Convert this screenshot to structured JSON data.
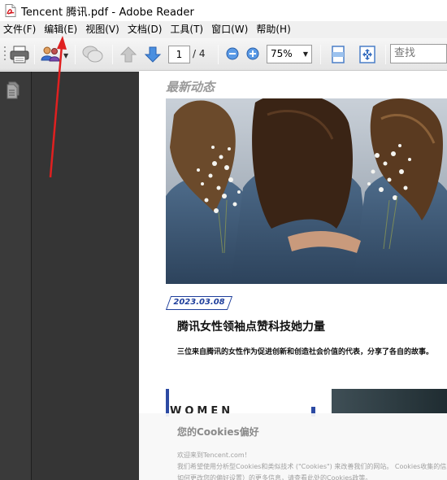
{
  "window": {
    "title": "Tencent 腾讯.pdf - Adobe Reader"
  },
  "menu": {
    "items": [
      "文件(F)",
      "编辑(E)",
      "视图(V)",
      "文档(D)",
      "工具(T)",
      "窗口(W)",
      "帮助(H)"
    ]
  },
  "toolbar": {
    "current_page": "1",
    "total_pages": "/ 4",
    "zoom": "75%",
    "search_placeholder": "查找"
  },
  "document": {
    "section_title": "最新动态",
    "date": "2023.03.08",
    "article_title": "腾讯女性领袖点赞科技她力量",
    "article_desc": "三位来自腾讯的女性作为促进创新和创造社会价值的代表，分享了各自的故事。",
    "women_heading": "WOMEN"
  },
  "cookie": {
    "title": "您的Cookies偏好",
    "line1": "欢迎来到Tencent.com！",
    "line2": "我们希望使用分析型Cookies和类似技术 (\"Cookies\") 来改善我们的网站。 Cookies收集的信息不",
    "line3": "如何更改您的偏好设置）的更多信息，请查看此处的Cookies政策。"
  },
  "colors": {
    "accent_blue": "#1f3f9c",
    "annotation_red": "#e02020"
  }
}
